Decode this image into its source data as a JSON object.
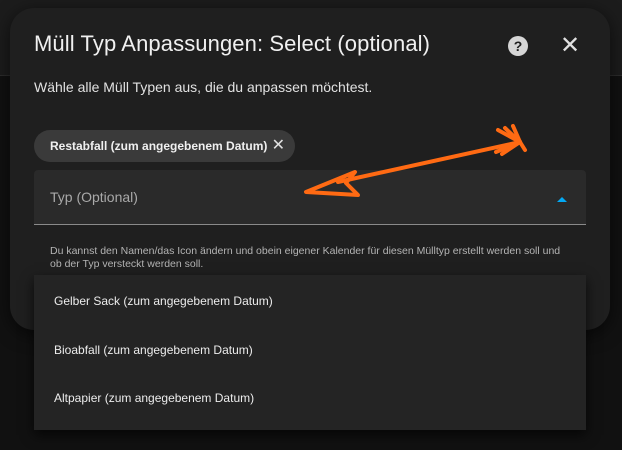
{
  "dialog": {
    "title": "Müll Typ Anpassungen: Select (optional)",
    "help_icon": "?",
    "close_icon": "✕",
    "description": "Wähle alle Müll Typen aus, die du anpassen möchtest."
  },
  "chips": [
    {
      "label": "Restabfall (zum angegebenem Datum)",
      "remove_icon": "✕"
    }
  ],
  "select": {
    "label": "Typ (Optional)",
    "helper": "Du kannst den Namen/das Icon ändern und obein eigener Kalender für diesen Mülltyp erstellt werden soll und ob der Typ versteckt werden soll.",
    "expanded": true,
    "accent_color": "#03a9f4"
  },
  "menu": {
    "items": [
      {
        "label": "Gelber Sack (zum angegebenem Datum)"
      },
      {
        "label": "Bioabfall (zum angegebenem Datum)"
      },
      {
        "label": "Altpapier (zum angegebenem Datum)"
      }
    ]
  },
  "annotation": {
    "arrow_color": "#ff6a13"
  }
}
